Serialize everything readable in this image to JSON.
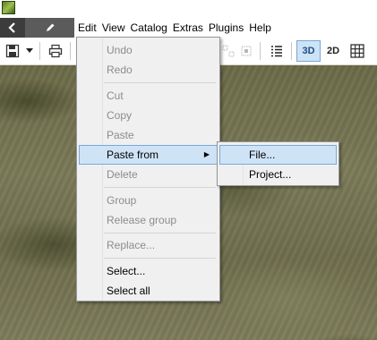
{
  "menubar": {
    "items": [
      {
        "label": "Edit"
      },
      {
        "label": "View"
      },
      {
        "label": "Catalog"
      },
      {
        "label": "Extras"
      },
      {
        "label": "Plugins"
      },
      {
        "label": "Help"
      }
    ]
  },
  "toolbar": {
    "view_3d_label": "3D",
    "view_2d_label": "2D",
    "active_view": "3D"
  },
  "edit_menu": {
    "undo": "Undo",
    "redo": "Redo",
    "cut": "Cut",
    "copy": "Copy",
    "paste": "Paste",
    "paste_from": "Paste from",
    "delete": "Delete",
    "group": "Group",
    "release_group": "Release group",
    "replace": "Replace...",
    "select": "Select...",
    "select_all": "Select all"
  },
  "paste_from_submenu": {
    "file": "File...",
    "project": "Project..."
  },
  "colors": {
    "highlight": "#cfe3f7",
    "highlight_border": "#79a9d8",
    "menu_bg": "#f0f0f0",
    "disabled_text": "#8c8c8c",
    "active_toggle": "#cde3f6"
  }
}
